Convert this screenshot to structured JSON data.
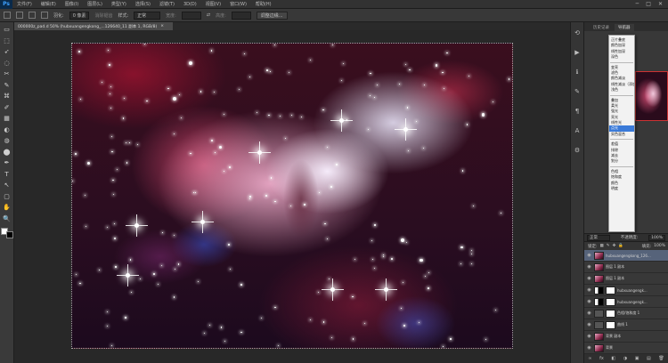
{
  "menubar": {
    "logo": "Ps",
    "items": [
      "文件(F)",
      "编辑(E)",
      "图像(I)",
      "图层(L)",
      "类型(Y)",
      "选择(S)",
      "滤镜(T)",
      "3D(D)",
      "视图(V)",
      "窗口(W)",
      "帮助(H)"
    ],
    "window_buttons": [
      "─",
      "□",
      "✕"
    ]
  },
  "options": {
    "feather_label": "羽化:",
    "feather_value": "0 像素",
    "antialias_label": "消除锯齿",
    "style_label": "样式:",
    "style_value": "正常",
    "width_label": "宽度:",
    "height_label": "高度:",
    "refine_button": "调整边缘..."
  },
  "document": {
    "tab_title": "000000z_pad.d 50% (hubxuangengkong_...126640_11 副本 1, RGB/8)",
    "close_icon": "×"
  },
  "tools": [
    "▭",
    "⬚",
    "➶",
    "◌",
    "✂",
    "✎",
    "⌘",
    "✐",
    "▦",
    "◐",
    "◍",
    "⬤",
    "✒",
    "T",
    "↖",
    "▢",
    "✋",
    "🔍"
  ],
  "panels": {
    "tabs": [
      "历史记录",
      "导航器"
    ]
  },
  "blend_dropdown": {
    "groups": [
      [
        "正片叠底",
        "颜色加深",
        "线性加深",
        "深色"
      ],
      [
        "变亮",
        "滤色",
        "颜色减淡",
        "线性减淡（添加）",
        "浅色"
      ],
      [
        "叠加",
        "柔光",
        "强光",
        "亮光",
        "线性光",
        "点光",
        "实色混合"
      ],
      [
        "差值",
        "排除",
        "减去",
        "划分"
      ],
      [
        "色相",
        "饱和度",
        "颜色",
        "明度"
      ]
    ],
    "selected": "点光"
  },
  "layers": {
    "blend_value": "正常",
    "opacity_label": "不透明度:",
    "opacity_value": "100%",
    "lock_label": "锁定:",
    "fill_label": "填充:",
    "fill_value": "100%",
    "rows": [
      {
        "name": "hubxuangengkong_126...",
        "thumb": "photo",
        "active": true
      },
      {
        "name": "图层 1 副本",
        "thumb": "photo",
        "active": false
      },
      {
        "name": "图层 1 副本",
        "thumb": "photo",
        "active": false
      },
      {
        "name": "hubxuangengk...",
        "thumb": "maskdark",
        "active": false
      },
      {
        "name": "hubxuangengk...",
        "thumb": "maskdark",
        "active": false
      },
      {
        "name": "色相/饱和度 1",
        "thumb": "adj",
        "active": false
      },
      {
        "name": "曲线 1",
        "thumb": "adj",
        "active": false
      },
      {
        "name": "背景 副本",
        "thumb": "photo",
        "active": false
      },
      {
        "name": "背景",
        "thumb": "photo",
        "active": false
      }
    ],
    "footer_icons": [
      "∞",
      "fx",
      "◧",
      "◑",
      "▣",
      "▤",
      "🗑"
    ]
  }
}
